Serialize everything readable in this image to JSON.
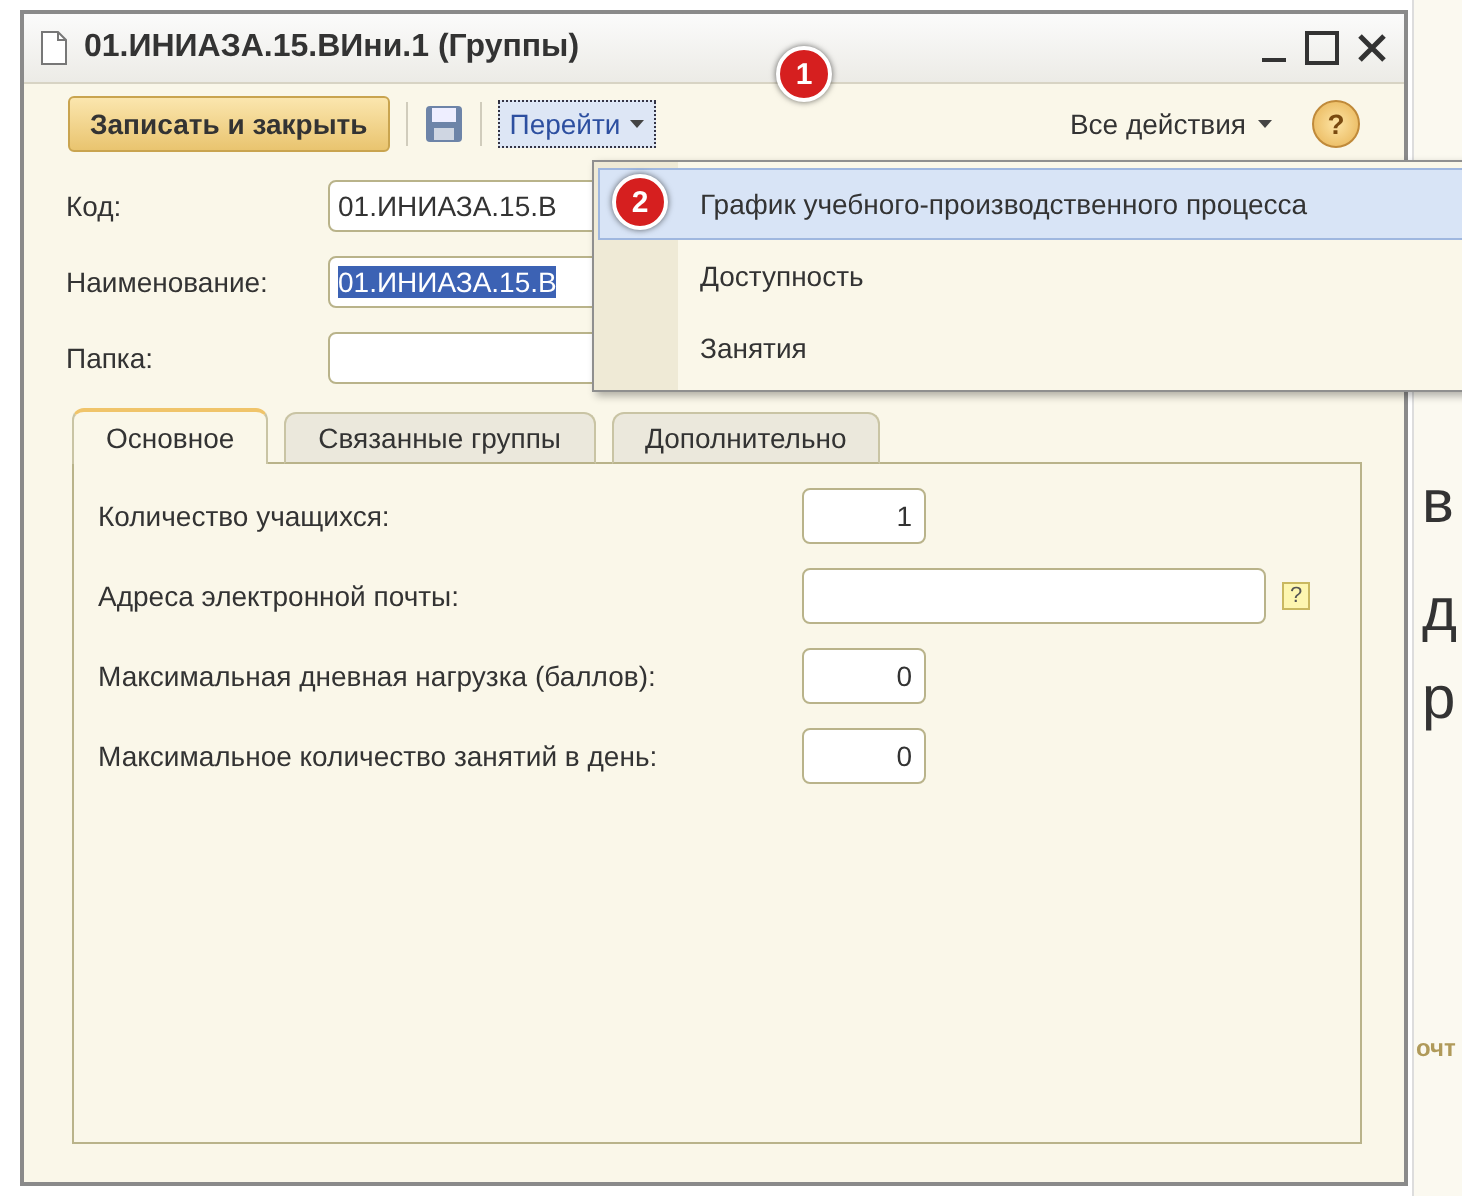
{
  "window": {
    "title": "01.ИНИАЗА.15.ВИни.1 (Группы)"
  },
  "toolbar": {
    "save_close": "Записать и закрыть",
    "goto": {
      "label": "Перейти",
      "expanded": true
    },
    "all_actions": "Все действия",
    "help": "?"
  },
  "callouts": [
    "1",
    "2"
  ],
  "goto_menu": [
    {
      "label": "График учебного-производственного процесса",
      "selected": true
    },
    {
      "label": "Доступность",
      "selected": false
    },
    {
      "label": "Занятия",
      "selected": false
    }
  ],
  "fields": [
    {
      "label": "Код:",
      "value": "01.ИНИАЗА.15.В"
    },
    {
      "label": "Наименование:",
      "value": "01.ИНИАЗА.15.В",
      "value_selected": true
    },
    {
      "label": "Папка:"
    }
  ],
  "tabs": [
    {
      "label": "Основное",
      "selected": true
    },
    {
      "label": "Связанные группы",
      "selected": false
    },
    {
      "label": "Дополнительно",
      "selected": false
    }
  ],
  "tab_fields": [
    {
      "label": "Количество учащихся:",
      "value": "1",
      "kind": "number"
    },
    {
      "label": "Адреса электронной почты:",
      "kind": "text",
      "hint": "?"
    },
    {
      "label": "Максимальная дневная нагрузка (баллов):",
      "value": "0",
      "kind": "number"
    },
    {
      "label": "Максимальное количество занятий в день:",
      "value": "0",
      "kind": "number"
    }
  ],
  "background_fragments": [
    "в",
    "д",
    "р",
    "очт"
  ]
}
